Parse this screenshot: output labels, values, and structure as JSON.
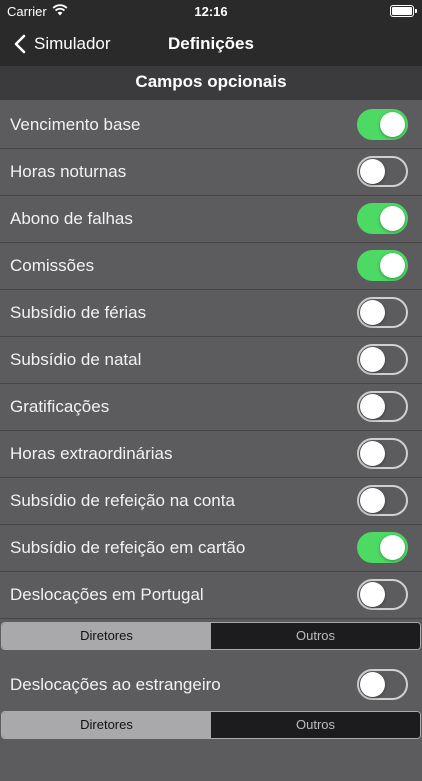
{
  "status": {
    "carrier": "Carrier",
    "time": "12:16"
  },
  "nav": {
    "back_label": "Simulador",
    "title": "Definições"
  },
  "section": {
    "title": "Campos opcionais"
  },
  "rows": [
    {
      "label": "Vencimento base",
      "on": true
    },
    {
      "label": "Horas noturnas",
      "on": false
    },
    {
      "label": "Abono de falhas",
      "on": true
    },
    {
      "label": "Comissões",
      "on": true
    },
    {
      "label": "Subsídio de férias",
      "on": false
    },
    {
      "label": "Subsídio de natal",
      "on": false
    },
    {
      "label": "Gratificações",
      "on": false
    },
    {
      "label": "Horas extraordinárias",
      "on": false
    },
    {
      "label": "Subsídio de refeição na conta",
      "on": false
    },
    {
      "label": "Subsídio de refeição em cartão",
      "on": true
    },
    {
      "label": "Deslocações em Portugal",
      "on": false
    }
  ],
  "segment1": {
    "options": [
      "Diretores",
      "Outros"
    ],
    "selected": "Diretores"
  },
  "row_abroad": {
    "label": "Deslocações ao estrangeiro",
    "on": false
  },
  "segment2": {
    "options": [
      "Diretores",
      "Outros"
    ],
    "selected": "Diretores"
  },
  "colors": {
    "toggle_on": "#4cd964",
    "background": "#5c5c5e",
    "bar": "#2a2a2b"
  }
}
